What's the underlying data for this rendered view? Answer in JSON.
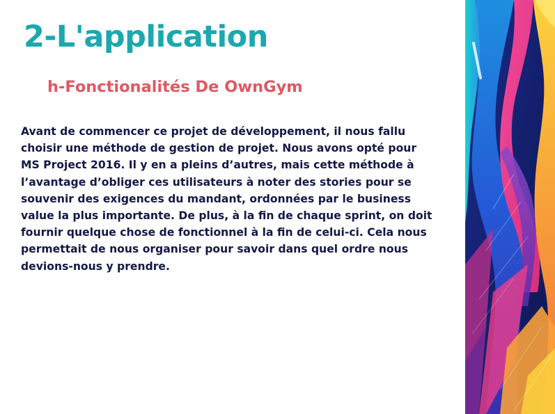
{
  "slide": {
    "title": "2-L'application",
    "subtitle": "h-Fonctionalités De OwnGym",
    "body": "Avant de commencer ce projet de développement, il nous fallu choisir une méthode de gestion de projet. Nous avons opté pour MS Project 2016. Il y en a pleins d’autres, mais cette méthode à l’avantage d’obliger ces utilisateurs à noter des stories pour se souvenir des exigences du mandant, ordonnées par le business value la plus importante. De plus, à la fin de chaque sprint, on doit fournir quelque chose de fonctionnel à la fin de celui-ci. Cela nous permettait de nous organiser pour savoir dans quel ordre nous devions-nous y prendre."
  },
  "colors": {
    "title": "#1ba8ae",
    "subtitle": "#e05862",
    "body_text": "#131946",
    "background": "#ffffff",
    "decor_navy": "#0f1d6e",
    "decor_blue": "#1f4fd1",
    "decor_pink": "#ef3d8a",
    "decor_orange": "#f58a3c",
    "decor_yellow": "#fbd13c",
    "decor_teal": "#29c0c6",
    "decor_purple": "#7a3fb8"
  }
}
